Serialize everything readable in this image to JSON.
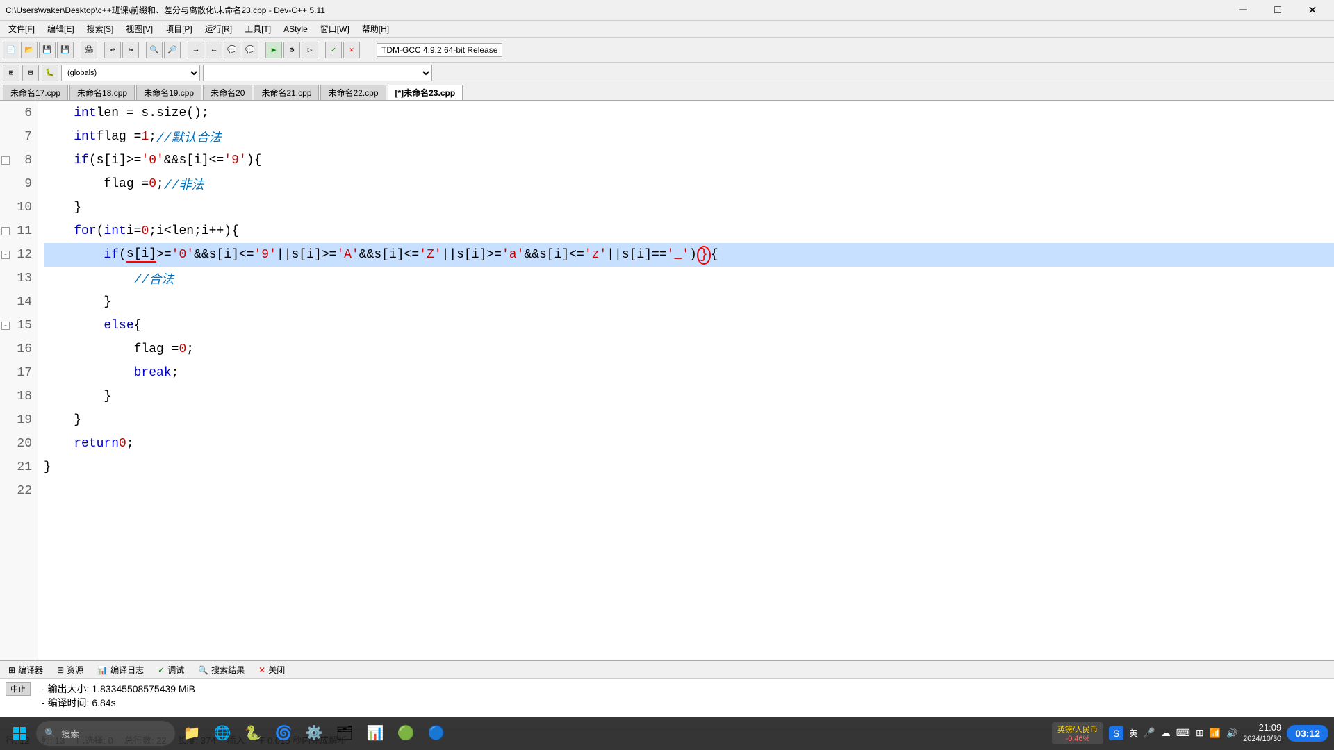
{
  "titlebar": {
    "title": "C:\\Users\\waker\\Desktop\\c++班课\\前缀和、差分与离散化\\未命名23.cpp - Dev-C++ 5.11",
    "minimize": "─",
    "maximize": "□",
    "close": "✕"
  },
  "menu": {
    "items": [
      "文件[F]",
      "编辑[E]",
      "搜索[S]",
      "视图[V]",
      "项目[P]",
      "运行[R]",
      "工具[T]",
      "AStyle",
      "窗口[W]",
      "帮助[H]"
    ]
  },
  "compiler_select": "TDM-GCC 4.9.2 64-bit Release",
  "globals_select": "(globals)",
  "tabs": {
    "items": [
      {
        "label": "未命名17.cpp",
        "active": false
      },
      {
        "label": "未命名18.cpp",
        "active": false
      },
      {
        "label": "未命名19.cpp",
        "active": false
      },
      {
        "label": "未命名20",
        "active": false
      },
      {
        "label": "未命名21.cpp",
        "active": false
      },
      {
        "label": "未命名22.cpp",
        "active": false
      },
      {
        "label": "[*]未命名23.cpp",
        "active": true
      }
    ]
  },
  "code": {
    "lines": [
      {
        "num": 6,
        "fold": false,
        "content": "    int len = s.size();",
        "highlighted": false
      },
      {
        "num": 7,
        "fold": false,
        "content": "    int flag = 1;//默认合法",
        "highlighted": false
      },
      {
        "num": 8,
        "fold": true,
        "content": "    if(s[i]>='0'&&s[i]<='9'){",
        "highlighted": false
      },
      {
        "num": 9,
        "fold": false,
        "content": "        flag = 0;  //非法",
        "highlighted": false
      },
      {
        "num": 10,
        "fold": false,
        "content": "    }",
        "highlighted": false
      },
      {
        "num": 11,
        "fold": true,
        "content": "    for(int i=0;i<len;i++){",
        "highlighted": false
      },
      {
        "num": 12,
        "fold": true,
        "content": "        if( s[i]>='0'&&s[i]<='9'||s[i]>='A'&&s[i]<='Z'||s[i]>='a'&&s[i]<='z'||s[i]=='_'){",
        "highlighted": true
      },
      {
        "num": 13,
        "fold": false,
        "content": "            //合法",
        "highlighted": false
      },
      {
        "num": 14,
        "fold": false,
        "content": "        }",
        "highlighted": false
      },
      {
        "num": 15,
        "fold": true,
        "content": "        else{",
        "highlighted": false
      },
      {
        "num": 16,
        "fold": false,
        "content": "            flag = 0;",
        "highlighted": false
      },
      {
        "num": 17,
        "fold": false,
        "content": "            break;",
        "highlighted": false
      },
      {
        "num": 18,
        "fold": false,
        "content": "        }",
        "highlighted": false
      },
      {
        "num": 19,
        "fold": false,
        "content": "    }",
        "highlighted": false
      },
      {
        "num": 20,
        "fold": false,
        "content": "    return 0;",
        "highlighted": false
      },
      {
        "num": 21,
        "fold": false,
        "content": "}",
        "highlighted": false
      },
      {
        "num": 22,
        "fold": false,
        "content": "",
        "highlighted": false
      }
    ]
  },
  "bottom": {
    "tabs": [
      {
        "icon": "⊞",
        "label": "编译器"
      },
      {
        "icon": "⊟",
        "label": "资源"
      },
      {
        "icon": "📊",
        "label": "编译日志"
      },
      {
        "icon": "✓",
        "label": "调试"
      },
      {
        "icon": "🔍",
        "label": "搜索结果"
      },
      {
        "icon": "✕",
        "label": "关闭"
      }
    ],
    "output_size": "输出大小: 1.83345508575439 MiB",
    "compile_time": "编译时间: 6.84s",
    "stop_btn": "中止"
  },
  "status": {
    "row": "行: 12",
    "col": "列: 13",
    "selected": "已选择: 0",
    "total": "总行数: 22",
    "length": "长度: 374",
    "insert": "插入",
    "parse_time": "在 0.015 秒内完成解析"
  },
  "taskbar": {
    "search_placeholder": "搜索",
    "time": "21:09",
    "date": "2024/10/30",
    "weather": "03:12",
    "stock": "英镑/人民币\n-0.46%"
  }
}
